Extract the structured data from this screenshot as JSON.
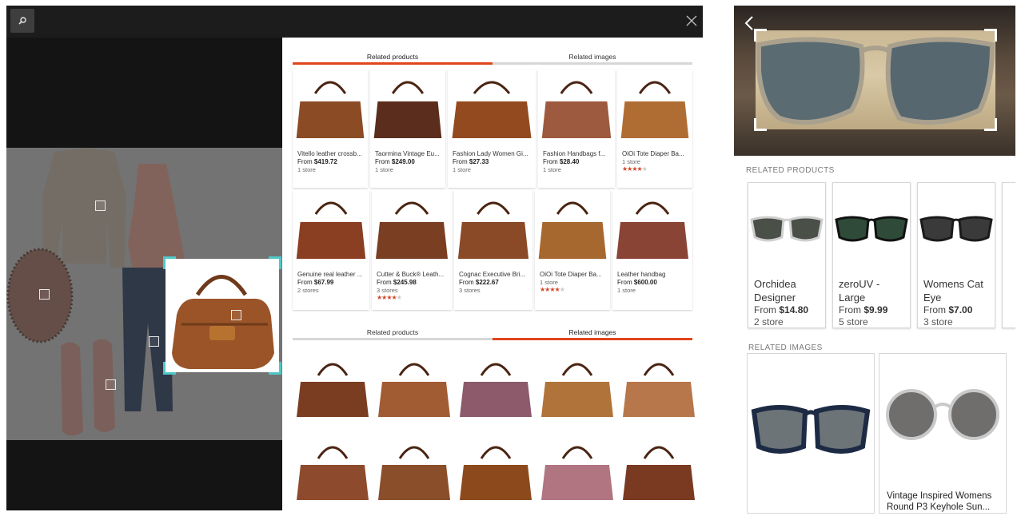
{
  "desktop": {
    "tabs_top": [
      {
        "label": "Related products",
        "active": true
      },
      {
        "label": "Related images",
        "active": false
      }
    ],
    "tabs_bottom": [
      {
        "label": "Related products",
        "active": false
      },
      {
        "label": "Related images",
        "active": true
      }
    ],
    "products": [
      {
        "title": "Vitello leather crossb...",
        "price_prefix": "From",
        "price": "$419.72",
        "stores": "1 store",
        "rating": null
      },
      {
        "title": "Taormina Vintage Eu...",
        "price_prefix": "From",
        "price": "$249.00",
        "stores": "1 store",
        "rating": null
      },
      {
        "title": "Fashion Lady Women Gi...",
        "price_prefix": "From",
        "price": "$27.33",
        "stores": "1 store",
        "rating": null
      },
      {
        "title": "Fashion Handbags f...",
        "price_prefix": "From",
        "price": "$28.40",
        "stores": "1 store",
        "rating": null
      },
      {
        "title": "OiOi Tote Diaper Ba...",
        "price_prefix": "",
        "price": "",
        "stores": "1 store",
        "rating": 3.5
      },
      {
        "title": "Genuine real leather ...",
        "price_prefix": "From",
        "price": "$67.99",
        "stores": "2 stores",
        "rating": null
      },
      {
        "title": "Cutter & Buck® Leath...",
        "price_prefix": "From",
        "price": "$245.98",
        "stores": "3 stores",
        "rating": 3.5
      },
      {
        "title": "Cognac Executive Bri...",
        "price_prefix": "From",
        "price": "$222.67",
        "stores": "3 stores",
        "rating": null
      },
      {
        "title": "OiOi Tote Diaper Ba...",
        "price_prefix": "",
        "price": "",
        "stores": "1 store",
        "rating": 3.5
      },
      {
        "title": "Leather handbag",
        "price_prefix": "From",
        "price": "$600.00",
        "stores": "1 store",
        "rating": null
      }
    ]
  },
  "mobile": {
    "related_products_label": "RELATED PRODUCTS",
    "related_images_label": "RELATED IMAGES",
    "products": [
      {
        "title": "Orchidea Designer",
        "price_prefix": "From",
        "price": "$14.80",
        "stores": "2 store"
      },
      {
        "title": "zeroUV - Large",
        "price_prefix": "From",
        "price": "$9.99",
        "stores": "5 store"
      },
      {
        "title": "Womens Cat Eye",
        "price_prefix": "From",
        "price": "$7.00",
        "stores": "3 store"
      }
    ],
    "image_caption": "Vintage Inspired Womens Round P3 Keyhole Sun..."
  },
  "colors": {
    "accent": "#e0451c",
    "crop_corner": "#4fc8c8",
    "star": "#d1462a"
  },
  "icons": [
    "search-icon",
    "close-icon",
    "back-chevron-icon",
    "star-icon"
  ]
}
